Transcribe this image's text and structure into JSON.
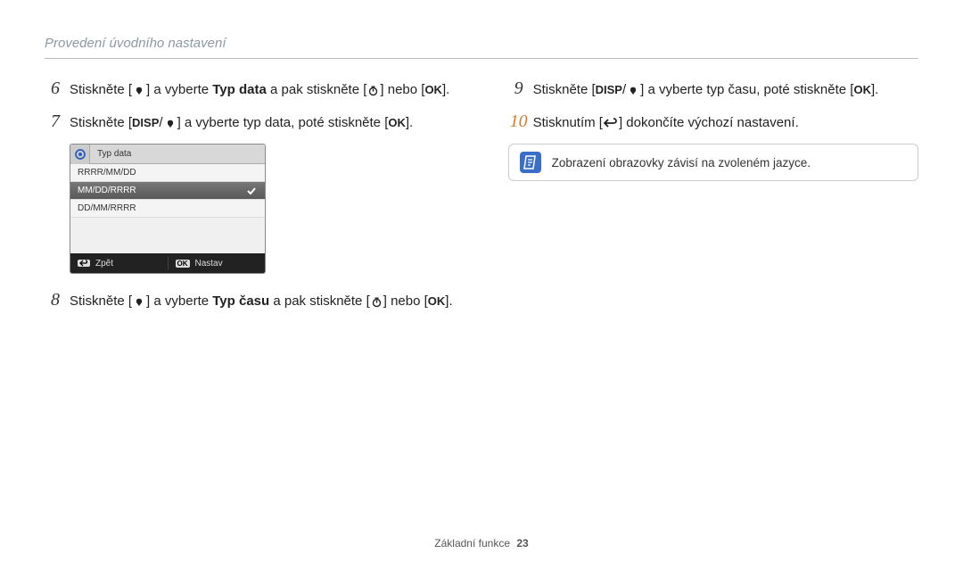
{
  "header": {
    "title": "Provedení úvodního nastavení"
  },
  "steps": {
    "6": {
      "pre": "Stiskněte [",
      "mid": "] a vyberte ",
      "bold": "Typ data",
      "post1": " a pak stiskněte [",
      "post2": "] nebo [",
      "post3": "]."
    },
    "7": {
      "pre": "Stiskněte [",
      "key": "DISP",
      "slash": "/",
      "mid": "] a vyberte typ data, poté stiskněte [",
      "post": "]."
    },
    "8": {
      "pre": "Stiskněte [",
      "mid": "] a vyberte ",
      "bold": "Typ času",
      "post1": " a pak stiskněte [",
      "post2": "] nebo [",
      "post3": "]."
    },
    "9": {
      "pre": "Stiskněte [",
      "key": "DISP",
      "slash": "/",
      "mid": "] a vyberte typ času, poté stiskněte [",
      "post": "]."
    },
    "10": {
      "pre": "Stisknutím [",
      "post": "] dokončíte výchozí nastavení."
    }
  },
  "menu": {
    "header": "Typ data",
    "items": [
      "RRRR/MM/DD",
      "MM/DD/RRRR",
      "DD/MM/RRRR"
    ],
    "selected_index": 1,
    "footer_left": "Zpět",
    "footer_right": "Nastav"
  },
  "note": {
    "text": "Zobrazení obrazovky závisí na zvoleném jazyce."
  },
  "words": {
    "nebo": "nebo",
    "ok": "OK"
  },
  "footer": {
    "section": "Základní funkce",
    "page": "23"
  }
}
